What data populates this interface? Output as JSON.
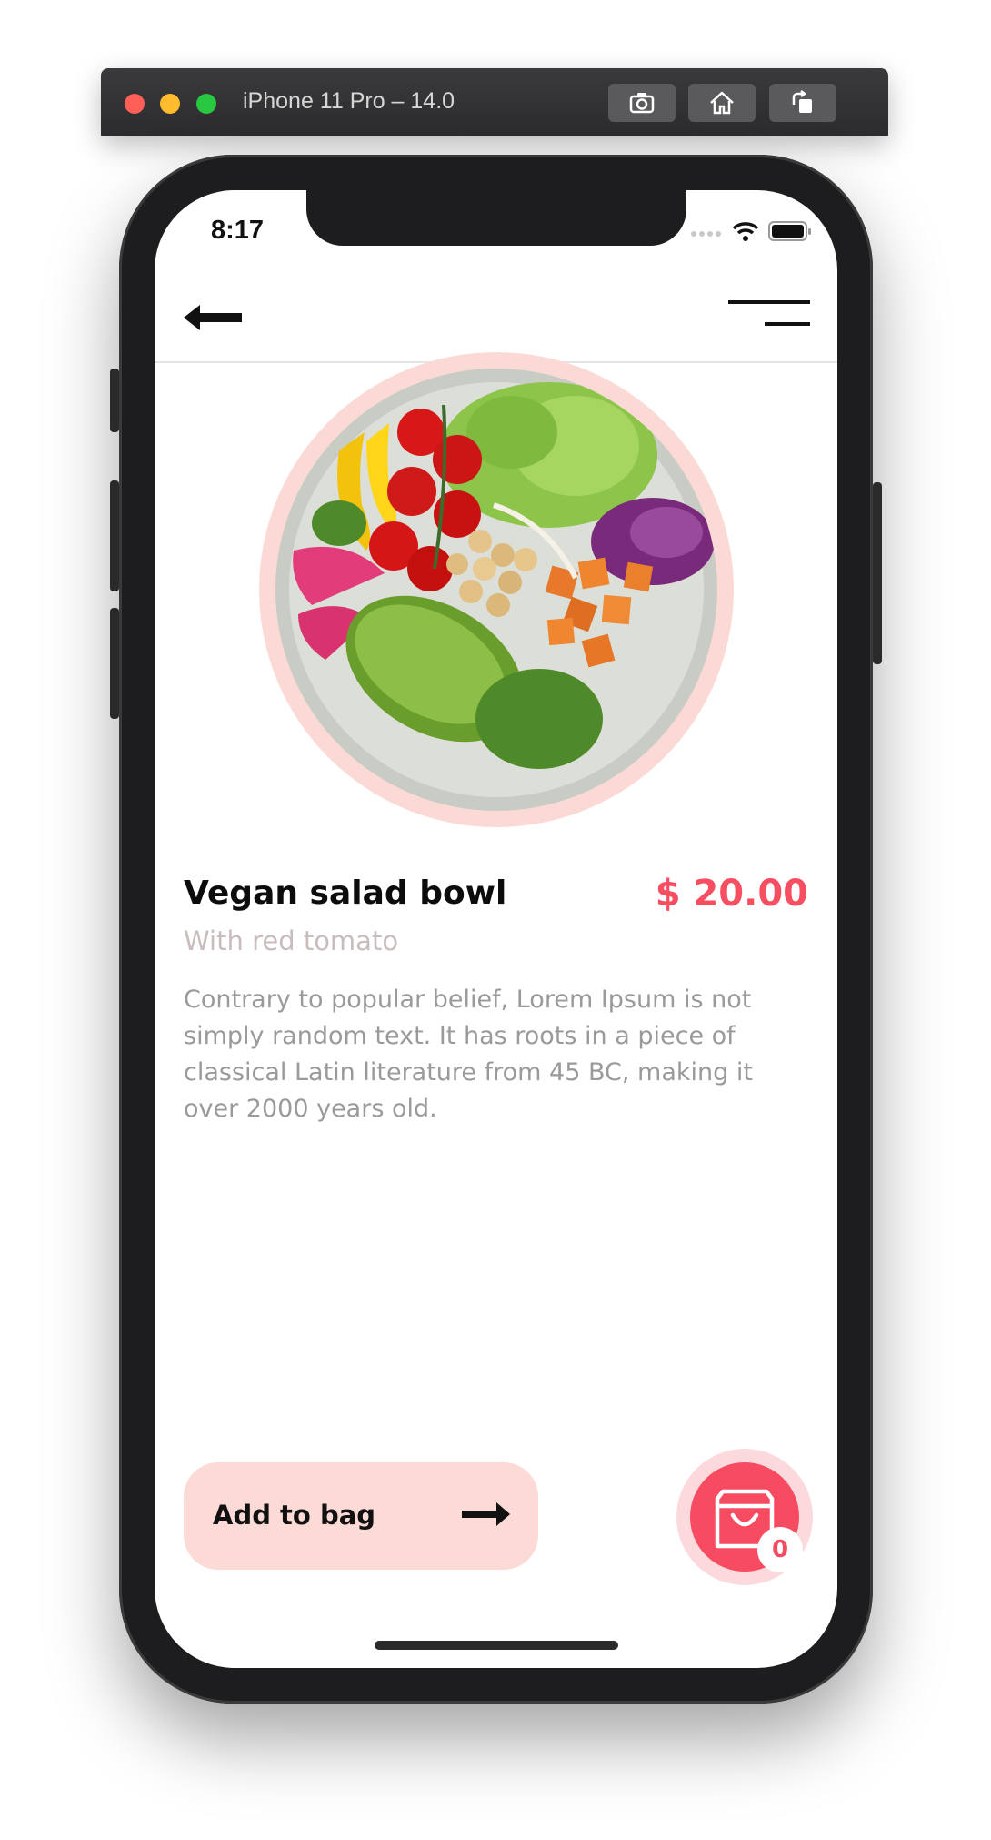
{
  "simulator": {
    "title": "iPhone 11 Pro – 14.0",
    "buttons": [
      "screenshot",
      "home",
      "rotate"
    ]
  },
  "status_bar": {
    "time": "8:17"
  },
  "product": {
    "name": "Vegan salad bowl",
    "price": "$ 20.00",
    "subtitle": "With red tomato",
    "description": "Contrary to popular belief, Lorem Ipsum is not simply random text. It has roots in a piece of classical Latin literature from 45 BC, making it over 2000 years old."
  },
  "actions": {
    "add_to_bag_label": "Add to bag",
    "bag_count": "0"
  },
  "colors": {
    "accent": "#f74e61",
    "pale_pink": "#fcdad6",
    "subtitle_gray": "#c9bcbc",
    "body_gray": "#9a9a9a"
  },
  "icons": {
    "back": "arrow-left-icon",
    "menu": "menu-icon",
    "add": "arrow-right-icon",
    "bag": "shopping-bag-icon"
  }
}
